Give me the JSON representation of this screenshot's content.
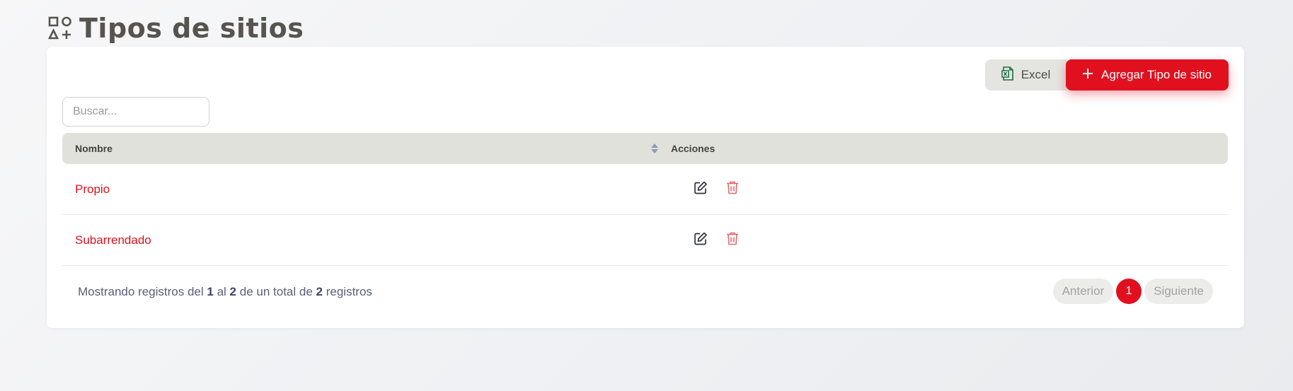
{
  "page": {
    "title": "Tipos de sitios",
    "icon": "shapes-icon"
  },
  "toolbar": {
    "excel_label": "Excel",
    "excel_icon": "excel-file-icon",
    "add_label": "Agregar Tipo de sitio",
    "add_icon": "plus-icon"
  },
  "search": {
    "placeholder": "Buscar...",
    "value": ""
  },
  "table": {
    "columns": [
      "Nombre",
      "Acciones"
    ],
    "rows": [
      {
        "name": "Propio"
      },
      {
        "name": "Subarrendado"
      }
    ],
    "action_icons": [
      "edit-icon",
      "trash-icon"
    ]
  },
  "footer": {
    "info_prefix": "Mostrando registros del",
    "from": "1",
    "info_mid1": "al",
    "to": "2",
    "info_mid2": "de un total de",
    "total": "2",
    "info_suffix": "registros"
  },
  "pagination": {
    "previous": "Anterior",
    "current_page": "1",
    "next": "Siguiente"
  },
  "colors": {
    "accent": "#e0101f",
    "title": "#55544f",
    "header_bg": "#e1e1dc",
    "excel_green": "#1d6f42"
  }
}
